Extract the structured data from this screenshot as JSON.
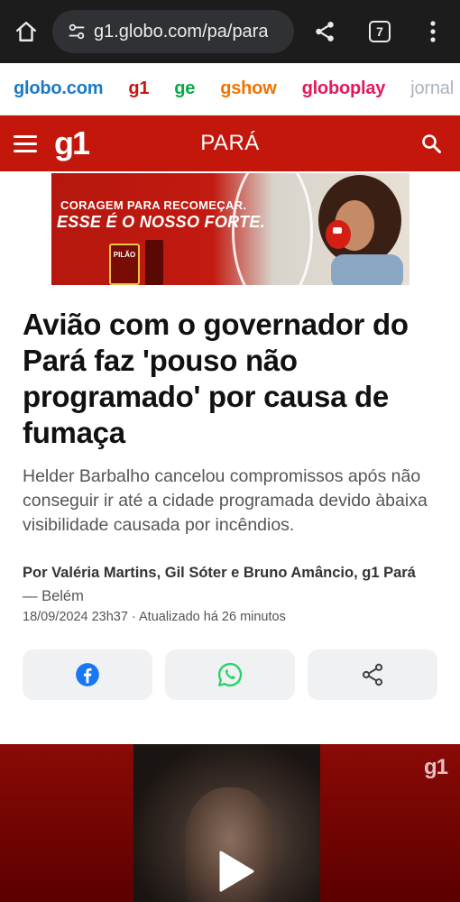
{
  "browser": {
    "url": "g1.globo.com/pa/para",
    "tab_count": "7"
  },
  "portals": [
    {
      "label": "globo.com",
      "color": "#1a7ac8"
    },
    {
      "label": "g1",
      "color": "#c4170c"
    },
    {
      "label": "ge",
      "color": "#06aa48"
    },
    {
      "label": "gshow",
      "color": "#f27200"
    },
    {
      "label": "globoplay",
      "color": "#e3195a"
    },
    {
      "label": "jornal",
      "color": "#a9b3bd"
    }
  ],
  "header": {
    "logo": "g1",
    "section": "PARÁ"
  },
  "ad": {
    "line1": "CORAGEM PARA RECOMEÇAR.",
    "line2": "ESSE É O NOSSO FORTE.",
    "product": "PILÃO"
  },
  "article": {
    "headline": "Avião com o governador do Pará faz 'pouso não programado' por causa de fumaça",
    "subtitle": "Helder Barbalho cancelou compromissos após não conseguir ir até a cidade programada devido àbaixa visibilidade causada por incêndios.",
    "authors": "Por Valéria Martins, Gil Sóter e Bruno Amâncio, g1 Pará",
    "place": "— Belém",
    "dateline": "18/09/2024 23h37 · Atualizado há 26 minutos"
  },
  "share": {
    "facebook_icon": "facebook-icon",
    "whatsapp_icon": "whatsapp-icon",
    "share_icon": "share-icon"
  },
  "video": {
    "watermark": "g1"
  },
  "colors": {
    "brand_red": "#c4170c",
    "facebook_blue": "#1877f2",
    "whatsapp_green": "#25d366"
  }
}
